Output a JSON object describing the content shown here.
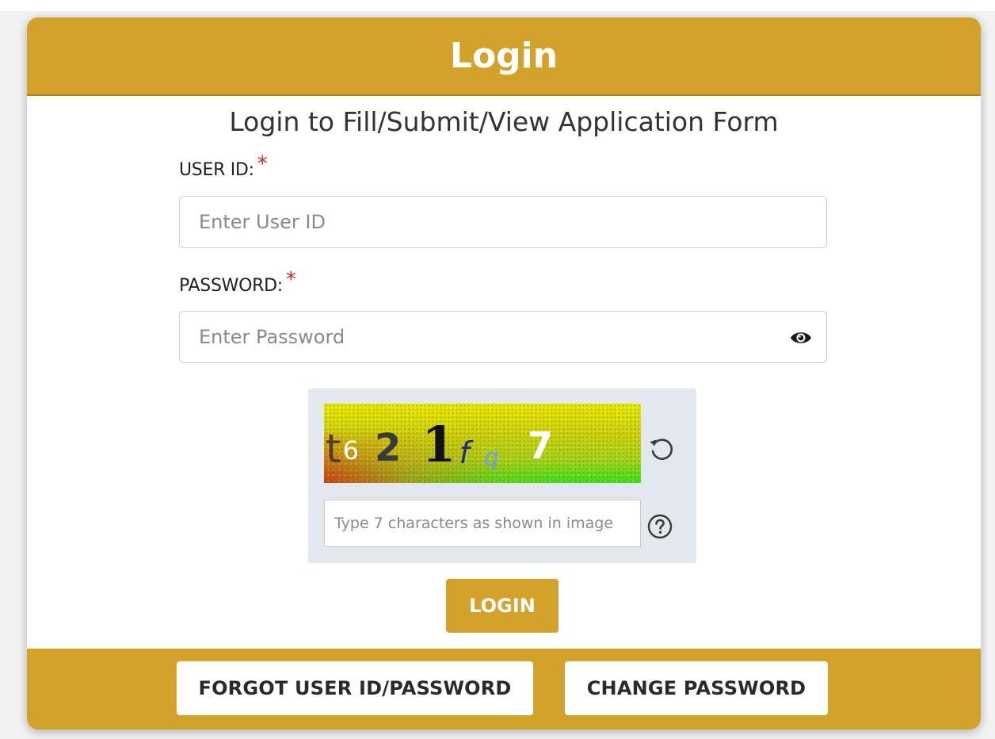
{
  "header": {
    "title": "Login"
  },
  "form": {
    "subtitle": "Login to Fill/Submit/View Application Form",
    "user_id": {
      "label": "USER ID:",
      "required_mark": "*",
      "placeholder": "Enter User ID",
      "value": ""
    },
    "password": {
      "label": "PASSWORD:",
      "required_mark": "*",
      "placeholder": "Enter Password",
      "value": "",
      "toggle_icon": "eye-icon"
    },
    "captcha": {
      "characters": [
        "t",
        "6",
        "2",
        "1",
        "f",
        "q",
        "7"
      ],
      "refresh_icon": "refresh-icon",
      "input_placeholder": "Type 7 characters as shown in image",
      "help_icon": "question-circle-icon"
    },
    "login_button": "LOGIN"
  },
  "footer": {
    "forgot_button": "FORGOT USER ID/PASSWORD",
    "change_button": "CHANGE PASSWORD"
  },
  "colors": {
    "brand_gold": "#d3a22b",
    "required_red": "#e0201f",
    "page_background": "#f2f2f2",
    "captcha_panel": "#e3e8ee"
  }
}
